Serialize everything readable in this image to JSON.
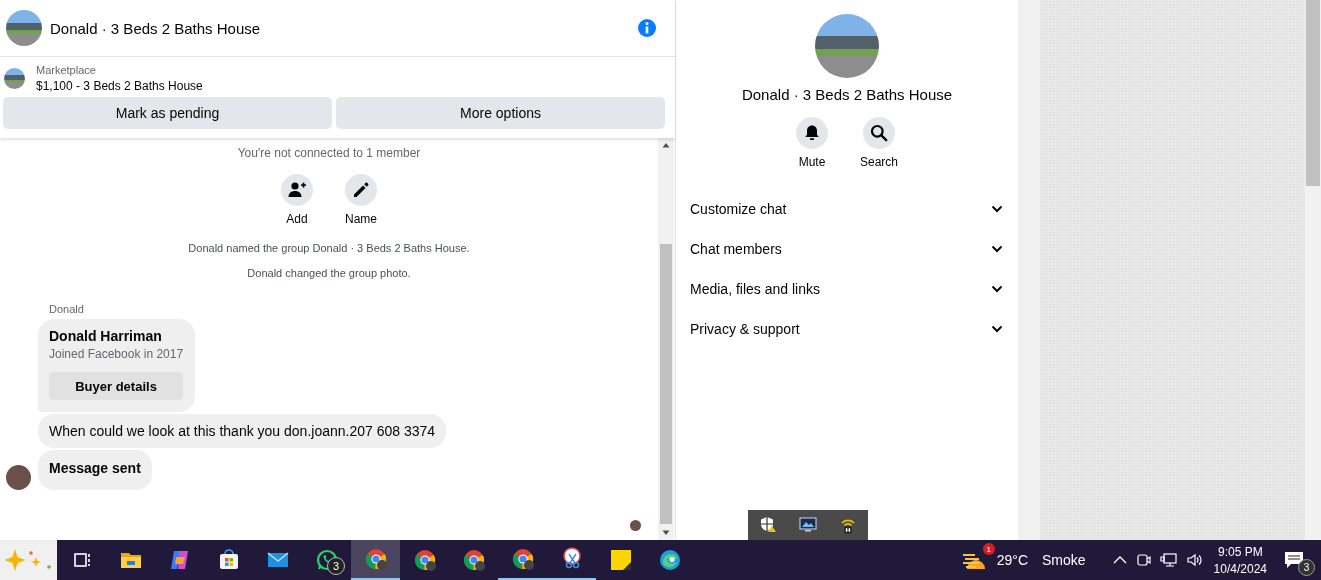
{
  "chat": {
    "title": "Donald · 3 Beds 2 Baths House",
    "listing": {
      "source": "Marketplace",
      "title": "$1,100 - 3 Beds 2 Baths House"
    },
    "actions": [
      "Mark as pending",
      "More options"
    ],
    "notices_top": [
      "You're not connected to 1 member"
    ],
    "group_actions": [
      {
        "kind": "add",
        "label": "Add"
      },
      {
        "kind": "name",
        "label": "Name"
      }
    ],
    "events": [
      "Donald named the group Donald · 3 Beds 2 Baths House.",
      "Donald changed the group photo."
    ],
    "sender": "Donald",
    "card": {
      "name": "Donald Harriman",
      "subtitle": "Joined Facebook in 2017",
      "button": "Buyer details"
    },
    "messages": [
      "When could we look at this thank you don.joann.207 608 3374",
      "Message sent"
    ]
  },
  "details": {
    "title": "Donald · 3 Beds 2 Baths House",
    "actions": [
      {
        "kind": "mute",
        "label": "Mute"
      },
      {
        "kind": "search",
        "label": "Search"
      }
    ],
    "sections": [
      {
        "label": "Customize chat",
        "expanded": false
      },
      {
        "label": "Chat members",
        "expanded": false
      },
      {
        "label": "Media, files and links",
        "expanded": false
      },
      {
        "label": "Privacy & support",
        "expanded": false
      }
    ]
  },
  "tray_popup": [
    {
      "kind": "shield"
    },
    {
      "kind": "monitor"
    },
    {
      "kind": "hotspot"
    }
  ],
  "taskbar": {
    "apps": [
      {
        "kind": "taskview",
        "selected": false,
        "running": false
      },
      {
        "kind": "folder",
        "selected": false,
        "running": false
      },
      {
        "kind": "copilot",
        "selected": false,
        "running": false
      },
      {
        "kind": "store",
        "selected": false,
        "running": false
      },
      {
        "kind": "mail",
        "selected": false,
        "running": false
      },
      {
        "kind": "chat",
        "selected": false,
        "running": false,
        "badge": "3"
      },
      {
        "kind": "browser",
        "selected": true,
        "running": true
      },
      {
        "kind": "browser",
        "selected": false,
        "running": false
      },
      {
        "kind": "browser",
        "selected": false,
        "running": false
      },
      {
        "kind": "browser",
        "selected": false,
        "running": true
      },
      {
        "kind": "snip",
        "selected": false,
        "running": true
      },
      {
        "kind": "note",
        "selected": false,
        "running": false
      },
      {
        "kind": "edge",
        "selected": false,
        "running": false
      }
    ],
    "weather": {
      "badge": "1",
      "temp": "29°C",
      "condition": "Smoke"
    },
    "time": "9:05 PM",
    "date": "10/4/2024",
    "notifications": "3"
  }
}
